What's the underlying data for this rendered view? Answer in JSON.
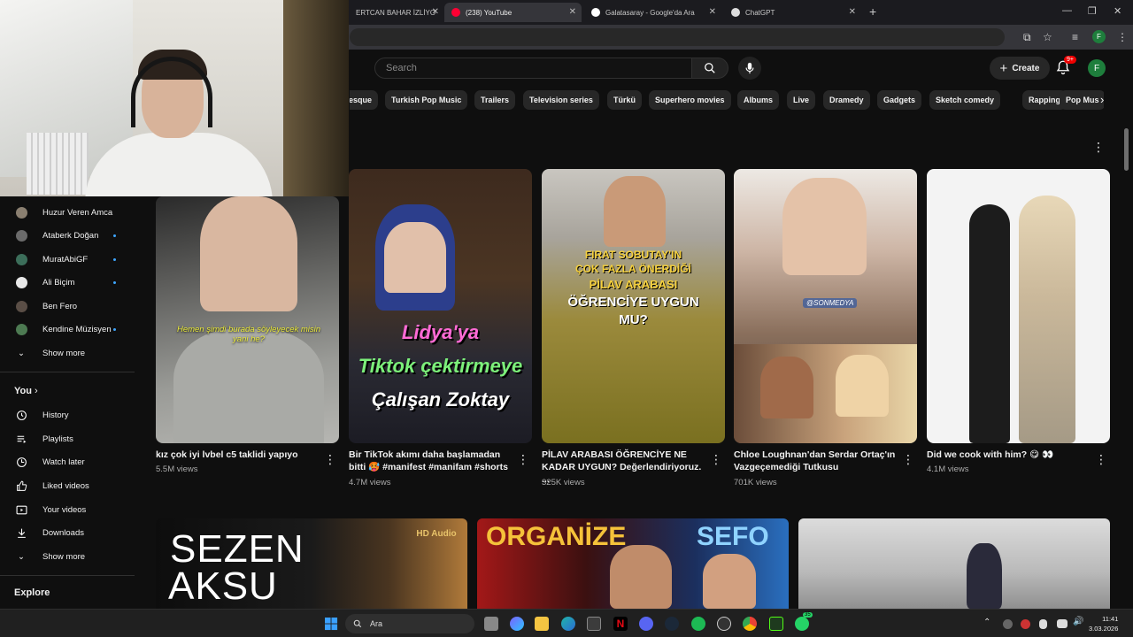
{
  "browser": {
    "tabs": [
      {
        "label": "ERTCAN BAHAR İZLİYO",
        "active": false
      },
      {
        "label": "(238) YouTube",
        "active": true
      },
      {
        "label": "Galatasaray - Google'da Ara",
        "active": false
      },
      {
        "label": "ChatGPT",
        "active": false
      }
    ],
    "new_tab": "+",
    "profile_initial": "F"
  },
  "header": {
    "search_placeholder": "Search",
    "create_label": "Create",
    "notification_count": "9+",
    "avatar_initial": "F"
  },
  "chips": [
    "esque",
    "Turkish Pop Music",
    "Trailers",
    "Television series",
    "Türkü",
    "Superhero movies",
    "Albums",
    "Live",
    "Dramedy",
    "Gadgets",
    "Sketch comedy",
    "Rapping",
    "Pop Mus"
  ],
  "sidebar": {
    "subscriptions": [
      {
        "label": "Huzur Veren Amca",
        "dot": false
      },
      {
        "label": "Ataberk Doğan",
        "dot": true
      },
      {
        "label": "MuratAbiGF",
        "dot": true
      },
      {
        "label": "Ali Biçim",
        "dot": true
      },
      {
        "label": "Ben Fero",
        "dot": false
      },
      {
        "label": "Kendine Müzisyen",
        "dot": true
      }
    ],
    "show_more_1": "Show more",
    "you_label": "You",
    "you_items": [
      {
        "label": "History",
        "icon": "history-icon"
      },
      {
        "label": "Playlists",
        "icon": "playlists-icon"
      },
      {
        "label": "Watch later",
        "icon": "watch-later-icon"
      },
      {
        "label": "Liked videos",
        "icon": "thumbs-up-icon"
      },
      {
        "label": "Your videos",
        "icon": "your-videos-icon"
      },
      {
        "label": "Downloads",
        "icon": "download-icon"
      }
    ],
    "show_more_2": "Show more",
    "explore_label": "Explore"
  },
  "shorts": [
    {
      "title": "kız çok iyi lvbel c5 taklidi yapıyo",
      "views": "5.5M views",
      "caption": "Hemen şimdi burada söyleyecek misin yani he?"
    },
    {
      "title": "Bir TikTok akımı daha başlamadan bitti 🥵 #manifest #manifam #shorts",
      "views": "4.7M views",
      "lines": [
        "Lidya'ya",
        "Tiktok çektirmeye",
        "Çalışan Zoktay"
      ]
    },
    {
      "title": "PİLAV ARABASI ÖĞRENCİYE NE KADAR UYGUN? Değerlendiriyoruz. ...",
      "views": "325K views",
      "lines": [
        "FIRAT SOBUTAY'IN",
        "ÇOK FAZLA ÖNERDİĞİ",
        "PİLAV ARABASI",
        "ÖĞRENCİYE UYGUN",
        "MU?"
      ]
    },
    {
      "title": "Chloe Loughnan'dan Serdar Ortaç'ın Vazgeçemediği Tutkusu",
      "views": "701K views",
      "tag": "@SONMEDYA"
    },
    {
      "title": "Did we cook with him? 😋 👀",
      "views": "4.1M views"
    }
  ],
  "bottom_row": [
    {
      "words": [
        "SEZEN",
        "AKSU"
      ],
      "badge": "HD Audio"
    },
    {
      "words": [
        "ORGANİZE",
        "SEFO"
      ]
    },
    {
      "words": []
    }
  ],
  "taskbar": {
    "search_placeholder": "Ara",
    "time": "11:41",
    "date": "3.03.2026",
    "whatsapp_badge": "35"
  },
  "colors": {
    "background": "#0f0f0f",
    "chip": "#272727",
    "accent_blue": "#3ea6ff",
    "notification_red": "#e00000"
  }
}
